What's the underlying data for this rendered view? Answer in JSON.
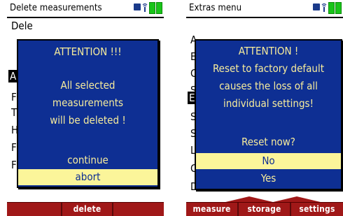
{
  "left_screen": {
    "title": "Delete measurements",
    "background_rows": [
      "Dele",
      "A",
      "F",
      "T",
      "H",
      "F",
      "F"
    ],
    "dialog": {
      "heading": "ATTENTION !!!",
      "lines": [
        "All selected",
        "measurements",
        "will be deleted !"
      ],
      "options": [
        "continue",
        "abort"
      ],
      "selected_option": "abort"
    },
    "softkeys": [
      "",
      "delete",
      ""
    ]
  },
  "right_screen": {
    "title": "Extras menu",
    "background_rows": [
      "A",
      "E",
      "C",
      "S",
      "E",
      "S",
      "S",
      "L",
      "C",
      "Device info remote control"
    ],
    "dialog": {
      "heading": "ATTENTION !",
      "lines": [
        "Reset to factory default",
        "causes the loss of all",
        "individual settings!",
        "",
        "Reset now?"
      ],
      "options": [
        "No",
        "Yes"
      ],
      "selected_option": "No"
    },
    "softkeys": [
      "measure",
      "storage",
      "settings"
    ]
  },
  "status_icons": [
    "power-plug-icon",
    "signal-icon",
    "battery-icon",
    "battery-icon"
  ],
  "colors": {
    "dialog_bg": "#0e2f93",
    "dialog_text": "#f7ec9c",
    "selection_bg": "#fbf59a",
    "softkey_bar": "#a01818",
    "battery": "#19c419"
  }
}
